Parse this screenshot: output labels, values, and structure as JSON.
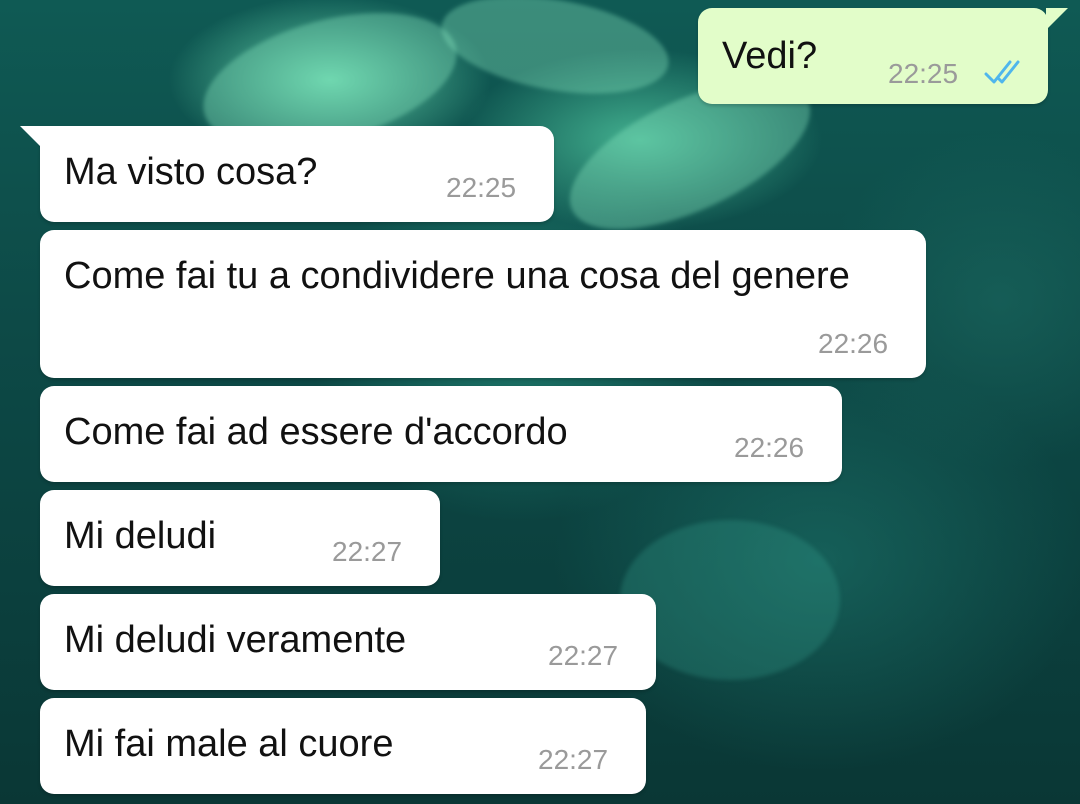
{
  "chat": {
    "messages": [
      {
        "direction": "outgoing",
        "text": "Vedi?",
        "time": "22:25",
        "status": "read-double-check-icon"
      },
      {
        "direction": "incoming",
        "text": "Ma visto cosa?",
        "time": "22:25"
      },
      {
        "direction": "incoming",
        "text": "Come fai tu a condividere una cosa del genere",
        "time": "22:26"
      },
      {
        "direction": "incoming",
        "text": "Come fai ad essere d'accordo",
        "time": "22:26"
      },
      {
        "direction": "incoming",
        "text": "Mi deludi",
        "time": "22:27"
      },
      {
        "direction": "incoming",
        "text": "Mi deludi veramente",
        "time": "22:27"
      },
      {
        "direction": "incoming",
        "text": "Mi fai male al cuore",
        "time": "22:27"
      }
    ]
  },
  "colors": {
    "outgoing_bubble": "#e2fdc9",
    "incoming_bubble": "#ffffff",
    "timestamp": "#9a9a9a",
    "read_ticks": "#4fb6ec"
  }
}
